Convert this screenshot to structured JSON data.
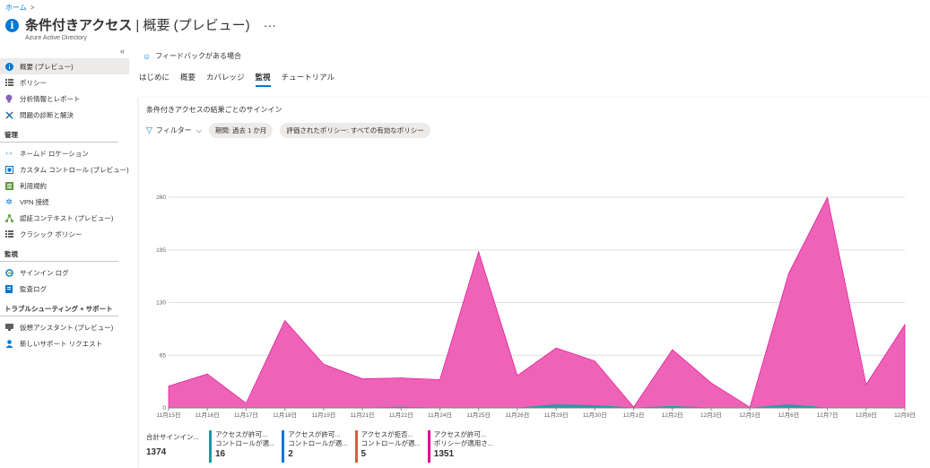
{
  "breadcrumb": {
    "home": "ホーム",
    "sep": ">"
  },
  "header": {
    "title_main": "条件付きアクセス",
    "title_sep": " | ",
    "title_sub": "概要 (プレビュー)",
    "more": "···",
    "subtitle": "Azure Active Directory"
  },
  "sidebar": {
    "collapse": "«",
    "items_top": [
      {
        "label": "概要 (プレビュー)",
        "icon": "info-icon",
        "active": true
      },
      {
        "label": "ポリシー",
        "icon": "list-icon"
      },
      {
        "label": "分析情報とレポート",
        "icon": "lightbulb-icon"
      },
      {
        "label": "問題の診断と解決",
        "icon": "wrench-icon"
      }
    ],
    "section_manage": "管理",
    "items_manage": [
      {
        "label": "ネームド ロケーション",
        "icon": "code-icon"
      },
      {
        "label": "カスタム コントロール (プレビュー)",
        "icon": "control-icon"
      },
      {
        "label": "利用規約",
        "icon": "checklist-icon"
      },
      {
        "label": "VPN 接続",
        "icon": "gear-icon"
      },
      {
        "label": "認証コンテキスト (プレビュー)",
        "icon": "network-icon"
      },
      {
        "label": "クラシック ポリシー",
        "icon": "list-icon"
      }
    ],
    "section_monitor": "監視",
    "items_monitor": [
      {
        "label": "サインイン ログ",
        "icon": "signin-icon"
      },
      {
        "label": "監査ログ",
        "icon": "audit-icon"
      }
    ],
    "section_support": "トラブルシューティング + サポート",
    "items_support": [
      {
        "label": "仮想アシスタント (プレビュー)",
        "icon": "assistant-icon"
      },
      {
        "label": "新しいサポート リクエスト",
        "icon": "person-icon"
      }
    ]
  },
  "main": {
    "feedback": "フィードバックがある場合",
    "tabs": [
      "はじめに",
      "概要",
      "カバレッジ",
      "監視",
      "チュートリアル"
    ],
    "active_tab": "監視"
  },
  "card": {
    "title": "条件付きアクセスの結果ごとのサインイン",
    "filter_label": "フィルター",
    "pill_period": "期間: 過去 1 か月",
    "pill_policy": "評価されたポリシー: すべての有効なポリシー"
  },
  "colors": {
    "pink": "#e3008c",
    "pink_fill": "#ee62b8",
    "teal": "#00a2a8",
    "blue": "#0078d4",
    "orange": "#e8543f"
  },
  "chart_data": {
    "type": "area",
    "x": [
      "11月15日",
      "11月16日",
      "11月17日",
      "11月18日",
      "11月19日",
      "11月21日",
      "11月22日",
      "11月24日",
      "11月25日",
      "11月26日",
      "11月29日",
      "11月30日",
      "12月1日",
      "12月2日",
      "12月3日",
      "12月5日",
      "12月6日",
      "12月7日",
      "12月8日",
      "12月9日"
    ],
    "x_ticks": [
      "11月15日",
      "11月16日",
      "11月17日",
      "11月18日",
      "11月19日",
      "11月21日",
      "11月22日",
      "11月24日",
      "11月25日",
      "11月26日",
      "11月29日",
      "11月30日",
      "12月1日",
      "12月2日",
      "12月3日",
      "12月5日",
      "12月6日",
      "12月7日",
      "12月8日",
      "12月9日"
    ],
    "y_ticks": [
      0,
      65,
      130,
      195,
      260
    ],
    "ylim": [
      0,
      260
    ],
    "series": [
      {
        "values": [
          27,
          42,
          6,
          108,
          54,
          36,
          37,
          35,
          193,
          40,
          74,
          58,
          1,
          72,
          31,
          1,
          166,
          260,
          29,
          103
        ]
      },
      {
        "values": [
          0,
          0,
          0,
          0,
          0,
          0,
          1,
          0,
          0,
          0,
          4,
          3,
          0,
          2,
          0,
          0,
          4,
          0,
          0,
          0
        ]
      }
    ],
    "legend": [
      {
        "line1": "合計サインイン...",
        "line2": "",
        "value": "1374",
        "color": ""
      },
      {
        "line1": "アクセスが許可...",
        "line2": "コントロールが適...",
        "value": "16",
        "color": "#00a2a8"
      },
      {
        "line1": "アクセスが許可...",
        "line2": "コントロールが適...",
        "value": "2",
        "color": "#0078d4"
      },
      {
        "line1": "アクセスが拒否...",
        "line2": "コントロールが適...",
        "value": "5",
        "color": "#e8543f"
      },
      {
        "line1": "アクセスが許可...",
        "line2": "ポリシーが適用さ...",
        "value": "1351",
        "color": "#e3008c"
      }
    ]
  }
}
